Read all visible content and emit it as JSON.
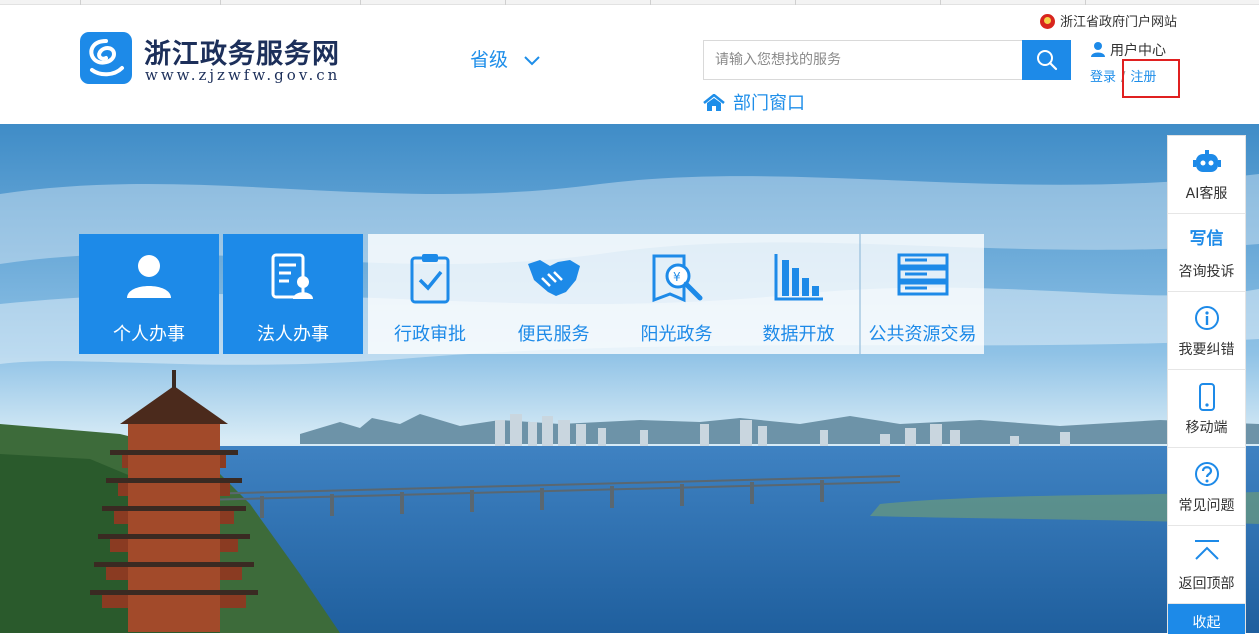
{
  "site": {
    "title": "浙江政务服务网",
    "url": "www.zjzwfw.gov.cn"
  },
  "header": {
    "region": "省级",
    "gov_portal": "浙江省政府门户网站",
    "search_placeholder": "请输入您想找的服务",
    "user_center": "用户中心",
    "login": "登录",
    "separator": "/",
    "register": "注册",
    "dept_window": "部门窗口"
  },
  "tiles": [
    {
      "label": "个人办事",
      "icon": "person-icon"
    },
    {
      "label": "法人办事",
      "icon": "legal-person-icon"
    },
    {
      "label": "行政审批",
      "icon": "clipboard-check-icon"
    },
    {
      "label": "便民服务",
      "icon": "handshake-icon"
    },
    {
      "label": "阳光政务",
      "icon": "document-search-icon"
    },
    {
      "label": "数据开放",
      "icon": "bar-chart-icon"
    },
    {
      "label": "公共资源交易",
      "icon": "server-stack-icon"
    }
  ],
  "sidebar": {
    "items": [
      {
        "label": "AI客服",
        "icon": "robot-icon"
      },
      {
        "label": "咨询投诉",
        "icon": "write-letter-icon",
        "icon_text": "写信"
      },
      {
        "label": "我要纠错",
        "icon": "info-icon"
      },
      {
        "label": "移动端",
        "icon": "mobile-icon"
      },
      {
        "label": "常见问题",
        "icon": "question-icon"
      },
      {
        "label": "返回顶部",
        "icon": "back-to-top-icon"
      }
    ],
    "collapse": "收起"
  },
  "colors": {
    "brand_blue": "#1d8ae8",
    "highlight_red": "#e02020",
    "title_navy": "#1c2f5a"
  }
}
